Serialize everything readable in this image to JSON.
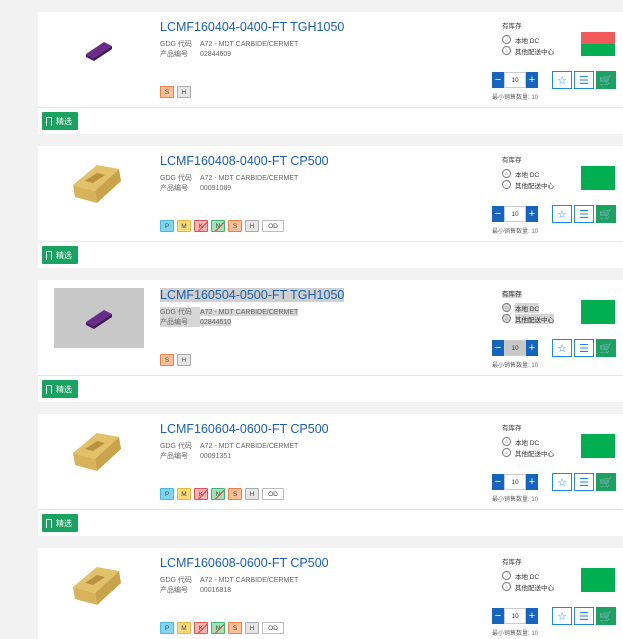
{
  "labels": {
    "gdg": "GDG 代码",
    "product_no": "产品编号",
    "in_stock": "有库存",
    "local_dc": "本地 DC",
    "other_dc": "其他配送中心",
    "min_qty": "最小销售数量: 10",
    "featured": "精选"
  },
  "colors": {
    "green": "#00b050",
    "red": "#f05a5a",
    "blue": "#1565c0"
  },
  "products": [
    {
      "name": "LCMF160404-0400-FT TGH1050",
      "category": "A72 - MDT CARBIDE/CERMET",
      "product_no": "02844609",
      "qty": "10",
      "image": "purple-insert",
      "status_colors": [
        "#f05a5a",
        "#00b050"
      ],
      "materials": [
        "S",
        "H"
      ]
    },
    {
      "name": "LCMF160408-0400-FT CP500",
      "category": "A72 - MDT CARBIDE/CERMET",
      "product_no": "00091089",
      "qty": "10",
      "image": "gold-insert",
      "status_colors": [
        "#00b050",
        "#00b050"
      ],
      "materials": [
        "P",
        "M",
        "K",
        "N",
        "S",
        "H",
        "OD"
      ]
    },
    {
      "name": "LCMF160504-0500-FT TGH1050",
      "category": "A72 - MDT CARBIDE/CERMET",
      "product_no": "02844610",
      "qty": "10",
      "image": "purple-insert",
      "status_colors": [
        "#00b050",
        "#00b050"
      ],
      "materials": [
        "S",
        "H"
      ]
    },
    {
      "name": "LCMF160604-0600-FT CP500",
      "category": "A72 - MDT CARBIDE/CERMET",
      "product_no": "00091351",
      "qty": "10",
      "image": "gold-insert",
      "status_colors": [
        "#00b050",
        "#00b050"
      ],
      "materials": [
        "P",
        "M",
        "K",
        "N",
        "S",
        "H",
        "OD"
      ]
    },
    {
      "name": "LCMF160608-0600-FT CP500",
      "category": "A72 - MDT CARBIDE/CERMET",
      "product_no": "00016818",
      "qty": "10",
      "image": "gold-insert",
      "status_colors": [
        "#00b050",
        "#00b050"
      ],
      "materials": [
        "P",
        "M",
        "K",
        "N",
        "S",
        "H",
        "OD"
      ]
    }
  ]
}
